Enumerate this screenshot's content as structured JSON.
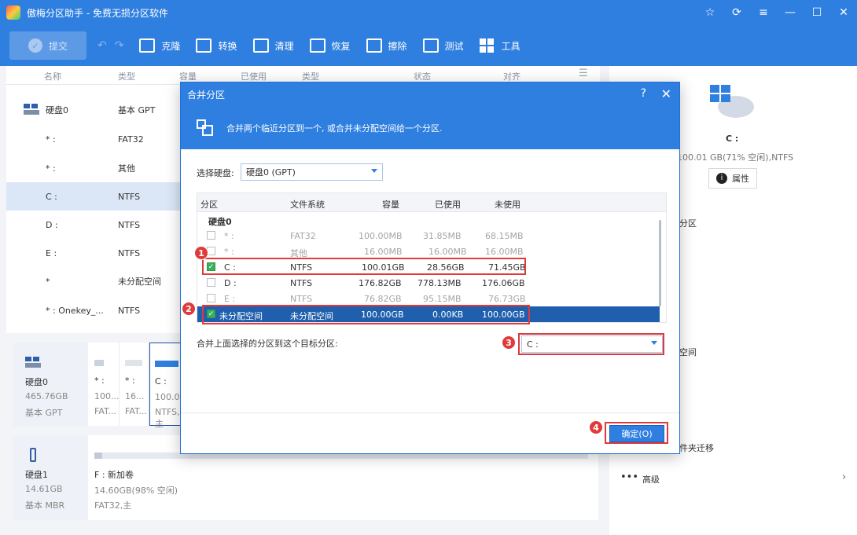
{
  "app": {
    "title": "傲梅分区助手 - 免费无损分区软件"
  },
  "toolbar": {
    "commit": "提交",
    "items": [
      "克隆",
      "转换",
      "清理",
      "恢复",
      "擦除",
      "测试",
      "工具"
    ]
  },
  "list": {
    "columns": [
      "名称",
      "类型",
      "容量",
      "已使用",
      "类型",
      "状态",
      "对齐"
    ],
    "rows": [
      {
        "name": "硬盘0",
        "type": "基本 GPT"
      },
      {
        "name": "* :",
        "type": "FAT32"
      },
      {
        "name": "* :",
        "type": "其他"
      },
      {
        "name": "C :",
        "type": "NTFS"
      },
      {
        "name": "D :",
        "type": "NTFS"
      },
      {
        "name": "E :",
        "type": "NTFS"
      },
      {
        "name": "*",
        "type": "未分配空间"
      },
      {
        "name": "* : Onekey_...",
        "type": "NTFS"
      }
    ]
  },
  "disk0_map": {
    "name": "硬盘0",
    "size": "465.76GB",
    "style": "基本 GPT",
    "segs": [
      {
        "letter": "* :",
        "size": "100...",
        "fs": "FAT..."
      },
      {
        "letter": "* :",
        "size": "16...",
        "fs": "FAT..."
      },
      {
        "letter": "C :",
        "size": "100.01",
        "fs": "NTFS,主"
      }
    ]
  },
  "disk1_map": {
    "name": "硬盘1",
    "size": "14.61GB",
    "style": "基本 MBR",
    "seg": {
      "label": "F : 新加卷",
      "size": "14.60GB(98% 空闲)",
      "fs": "FAT32,主"
    }
  },
  "right": {
    "drive": "C :",
    "info": "100.01 GB(71% 空闲),NTFS",
    "props": "属性",
    "frag1": "分区",
    "frag2": "空间",
    "frag3": "件夹迁移",
    "advanced": "高级"
  },
  "dialog": {
    "title": "合并分区",
    "help": "?",
    "close": "✕",
    "banner": "合并两个临近分区到一个, 或合并未分配空间给一个分区.",
    "disk_label": "选择硬盘:",
    "disk_value": "硬盘0 (GPT)",
    "table_headers": [
      "分区",
      "文件系统",
      "容量",
      "已使用",
      "未使用"
    ],
    "group": "硬盘0",
    "rows": [
      {
        "name": "* :",
        "fs": "FAT32",
        "cap": "100.00MB",
        "used": "31.85MB",
        "free": "68.15MB",
        "dim": true,
        "checked": false
      },
      {
        "name": "* :",
        "fs": "其他",
        "cap": "16.00MB",
        "used": "16.00MB",
        "free": "16.00MB",
        "dim": true,
        "checked": false
      },
      {
        "name": "C :",
        "fs": "NTFS",
        "cap": "100.01GB",
        "used": "28.56GB",
        "free": "71.45GB",
        "dim": false,
        "checked": true
      },
      {
        "name": "D :",
        "fs": "NTFS",
        "cap": "176.82GB",
        "used": "778.13MB",
        "free": "176.06GB",
        "dim": false,
        "checked": false
      },
      {
        "name": "E :",
        "fs": "NTFS",
        "cap": "76.82GB",
        "used": "95.15MB",
        "free": "76.73GB",
        "dim": true,
        "checked": false
      },
      {
        "name": "未分配空间",
        "fs": "未分配空间",
        "cap": "100.00GB",
        "used": "0.00KB",
        "free": "100.00GB",
        "dim": false,
        "checked": true,
        "highlight": true
      }
    ],
    "target_label": "合并上面选择的分区到这个目标分区:",
    "target_value": "C :",
    "ok": "确定(O)"
  },
  "badges": [
    "1",
    "2",
    "3",
    "4"
  ],
  "colors": {
    "accent": "#2f7fe0",
    "highlight": "#1f5fae",
    "annotation": "#e03a3a"
  }
}
